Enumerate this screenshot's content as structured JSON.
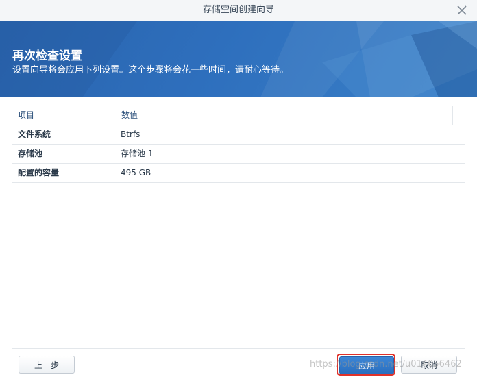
{
  "window": {
    "title": "存储空间创建向导",
    "close_icon": "close-icon"
  },
  "banner": {
    "heading": "再次检查设置",
    "subtitle": "设置向导将会应用下列设置。这个步骤将会花一些时间，请耐心等待。",
    "color": "#2e6fbd"
  },
  "table": {
    "headers": [
      "项目",
      "数值"
    ],
    "rows": [
      {
        "item": "文件系统",
        "value": "Btrfs"
      },
      {
        "item": "存储池",
        "value": "存储池 1"
      },
      {
        "item": "配置的容量",
        "value": "495 GB"
      }
    ]
  },
  "buttons": {
    "back_label": "上一步",
    "apply_label": "应用",
    "cancel_label": "取消",
    "apply_color": "#2f76c8",
    "highlight_color": "#e0322a"
  },
  "watermark": "https://blog.csdn.net/u014056462"
}
